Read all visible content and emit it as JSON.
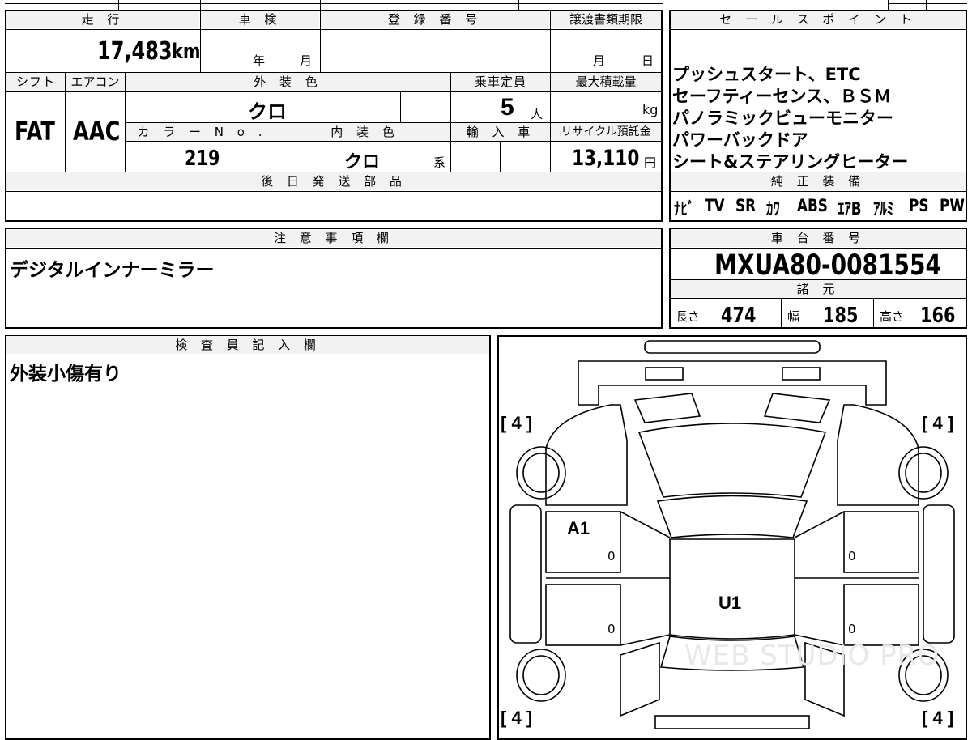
{
  "headers": {
    "mileage": "走 行",
    "inspection": "車 検",
    "registration": "登 録 番 号",
    "transfer": "譲渡書類期限",
    "sales_points": "セ ー ル ス ポ イ ン ト",
    "shift": "シフト",
    "aircon": "エアコン",
    "exterior_color": "外 装 色",
    "capacity": "乗車定員",
    "max_load": "最大積載量",
    "color_no": "カ ラ ー N o .",
    "interior_color": "内 装 色",
    "import": "輸 入 車",
    "recycle": "リサイクル預託金",
    "later_parts": "後 日 発 送 部 品",
    "genuine_equipment": "純 正 装 備",
    "notes": "注 意 事 項 欄",
    "chassis_no": "車 台 番 号",
    "specs": "諸 元",
    "inspector": "検 査 員 記 入 欄"
  },
  "values": {
    "mileage": "17,483",
    "mileage_unit": "km",
    "inspection_year_unit": "年",
    "inspection_month_unit": "月",
    "transfer_month_unit": "月",
    "transfer_day_unit": "日",
    "shift": "FAT",
    "aircon": "AAC",
    "exterior_color": "クロ",
    "capacity": "5",
    "capacity_unit": "人",
    "max_load_unit": "kg",
    "color_no": "219",
    "interior_color": "クロ",
    "interior_suffix": "系",
    "recycle_fee": "13,110",
    "recycle_unit": "円",
    "chassis_no": "MXUA80-0081554",
    "notes_text": "デジタルインナーミラー",
    "inspector_text": "外装小傷有り"
  },
  "sales_points": [
    "プッシュスタート、ETC",
    "セーフティーセンス、ＢＳＭ",
    "パノラミックビューモニター",
    "パワーバックドア",
    "シート&ステアリングヒーター"
  ],
  "equipment": [
    "ﾅﾋﾞ",
    "TV",
    "SR",
    "ｶﾜ",
    "ABS",
    "ｴｱB",
    "ｱﾙﾐ",
    "PS",
    "PW"
  ],
  "specs": {
    "length_label": "長さ",
    "length": "474",
    "width_label": "幅",
    "width": "185",
    "height_label": "高さ",
    "height": "166"
  },
  "diagram": {
    "tire_front_left": "4",
    "tire_front_right": "4",
    "tire_rear_left": "4",
    "tire_rear_right": "4",
    "mark_left_door": "A1",
    "mark_roof": "U1",
    "zero": "0",
    "watermark": "WEB STUDIO PRO"
  }
}
